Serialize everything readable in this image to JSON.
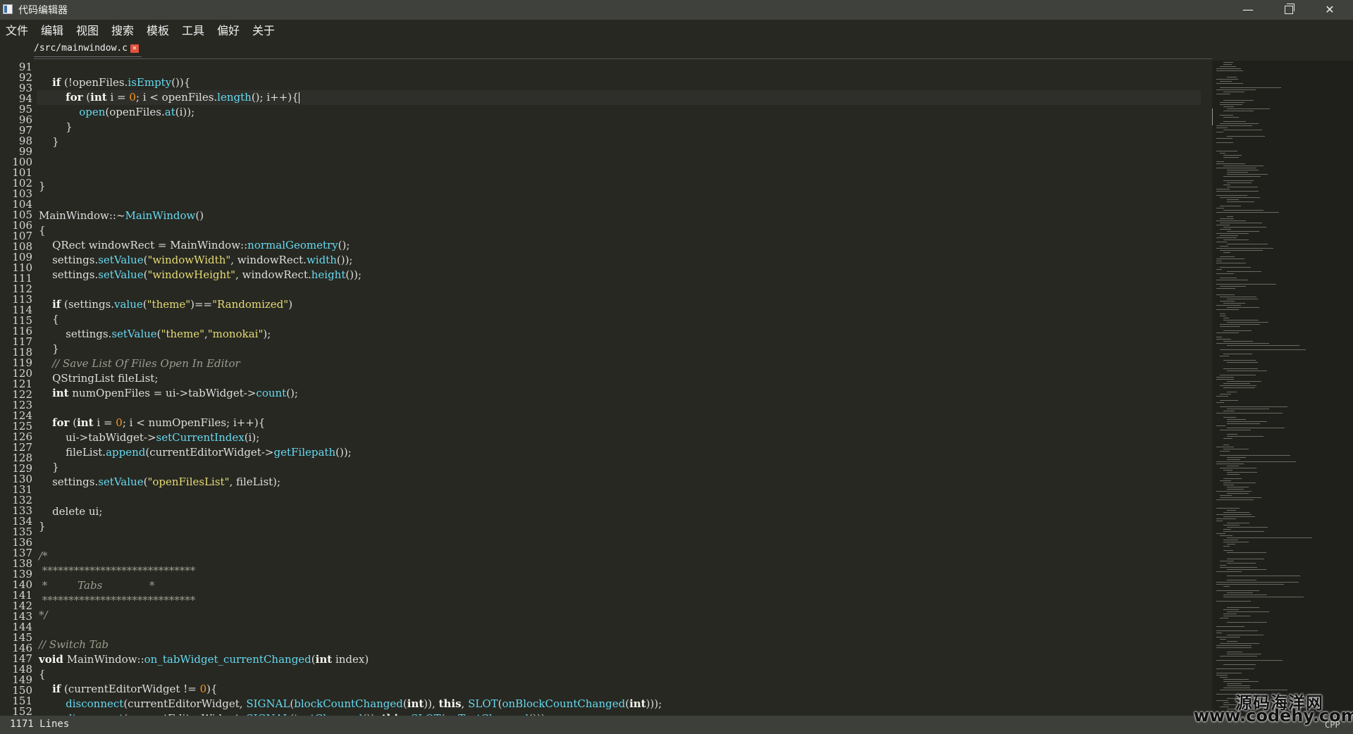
{
  "window": {
    "title": "代码编辑器",
    "minimize_glyph": "—",
    "close_glyph": "✕"
  },
  "menu": [
    "文件",
    "编辑",
    "视图",
    "搜索",
    "模板",
    "工具",
    "偏好",
    "关于"
  ],
  "tabs": [
    {
      "label": "/src/mainwindow.c",
      "close_glyph": "✕"
    }
  ],
  "editor": {
    "line_numbers": [
      "91",
      "92",
      "93",
      "94",
      "95",
      "96",
      "97",
      "98",
      "99",
      "100",
      "101",
      "102",
      "103",
      "104",
      "105",
      "106",
      "107",
      "108",
      "109",
      "110",
      "111",
      "112",
      "113",
      "114",
      "115",
      "116",
      "117",
      "118",
      "119",
      "120",
      "121",
      "122",
      "123",
      "124",
      "125",
      "126",
      "127",
      "128",
      "129",
      "130",
      "131",
      "132",
      "133",
      "134",
      "135",
      "136",
      "137",
      "138",
      "139",
      "140",
      "141",
      "142",
      "143",
      "144",
      "145",
      "146",
      "147",
      "148",
      "149",
      "150",
      "151",
      "152"
    ],
    "current_line": 94,
    "code_lines": [
      [],
      [
        {
          "t": "    "
        },
        {
          "c": "kw",
          "t": "if"
        },
        {
          "t": " (!openFiles."
        },
        {
          "c": "fn",
          "t": "isEmpty"
        },
        {
          "t": "()){"
        }
      ],
      [
        {
          "t": "        "
        },
        {
          "c": "kw",
          "t": "for"
        },
        {
          "t": " ("
        },
        {
          "c": "kw",
          "t": "int"
        },
        {
          "t": " i = "
        },
        {
          "c": "num",
          "t": "0"
        },
        {
          "t": "; i < openFiles."
        },
        {
          "c": "fn",
          "t": "length"
        },
        {
          "t": "(); i++){"
        }
      ],
      [
        {
          "t": "            "
        },
        {
          "c": "fn",
          "t": "open"
        },
        {
          "t": "(openFiles."
        },
        {
          "c": "fn",
          "t": "at"
        },
        {
          "t": "(i));"
        }
      ],
      [
        {
          "t": "        }"
        }
      ],
      [
        {
          "t": "    }"
        }
      ],
      [],
      [],
      [
        {
          "t": "}"
        }
      ],
      [],
      [
        {
          "t": "MainWindow::~"
        },
        {
          "c": "fn",
          "t": "MainWindow"
        },
        {
          "t": "()"
        }
      ],
      [
        {
          "t": "{"
        }
      ],
      [
        {
          "t": "    QRect windowRect = MainWindow::"
        },
        {
          "c": "fn",
          "t": "normalGeometry"
        },
        {
          "t": "();"
        }
      ],
      [
        {
          "t": "    settings."
        },
        {
          "c": "fn",
          "t": "setValue"
        },
        {
          "t": "("
        },
        {
          "c": "str",
          "t": "\"windowWidth\""
        },
        {
          "t": ", windowRect."
        },
        {
          "c": "fn",
          "t": "width"
        },
        {
          "t": "());"
        }
      ],
      [
        {
          "t": "    settings."
        },
        {
          "c": "fn",
          "t": "setValue"
        },
        {
          "t": "("
        },
        {
          "c": "str",
          "t": "\"windowHeight\""
        },
        {
          "t": ", windowRect."
        },
        {
          "c": "fn",
          "t": "height"
        },
        {
          "t": "());"
        }
      ],
      [],
      [
        {
          "t": "    "
        },
        {
          "c": "kw",
          "t": "if"
        },
        {
          "t": " (settings."
        },
        {
          "c": "fn",
          "t": "value"
        },
        {
          "t": "("
        },
        {
          "c": "str",
          "t": "\"theme\""
        },
        {
          "t": ")=="
        },
        {
          "c": "str",
          "t": "\"Randomized\""
        },
        {
          "t": ")"
        }
      ],
      [
        {
          "t": "    {"
        }
      ],
      [
        {
          "t": "        settings."
        },
        {
          "c": "fn",
          "t": "setValue"
        },
        {
          "t": "("
        },
        {
          "c": "str",
          "t": "\"theme\""
        },
        {
          "t": ","
        },
        {
          "c": "str",
          "t": "\"monokai\""
        },
        {
          "t": ");"
        }
      ],
      [
        {
          "t": "    }"
        }
      ],
      [
        {
          "t": "    "
        },
        {
          "c": "cm",
          "t": "// Save List Of Files Open In Editor"
        }
      ],
      [
        {
          "t": "    QStringList fileList;"
        }
      ],
      [
        {
          "t": "    "
        },
        {
          "c": "kw",
          "t": "int"
        },
        {
          "t": " numOpenFiles = ui->tabWidget->"
        },
        {
          "c": "fn",
          "t": "count"
        },
        {
          "t": "();"
        }
      ],
      [],
      [
        {
          "t": "    "
        },
        {
          "c": "kw",
          "t": "for"
        },
        {
          "t": " ("
        },
        {
          "c": "kw",
          "t": "int"
        },
        {
          "t": " i = "
        },
        {
          "c": "num",
          "t": "0"
        },
        {
          "t": "; i < numOpenFiles; i++){"
        }
      ],
      [
        {
          "t": "        ui->tabWidget->"
        },
        {
          "c": "fn",
          "t": "setCurrentIndex"
        },
        {
          "t": "(i);"
        }
      ],
      [
        {
          "t": "        fileList."
        },
        {
          "c": "fn",
          "t": "append"
        },
        {
          "t": "(currentEditorWidget->"
        },
        {
          "c": "fn",
          "t": "getFilepath"
        },
        {
          "t": "());"
        }
      ],
      [
        {
          "t": "    }"
        }
      ],
      [
        {
          "t": "    settings."
        },
        {
          "c": "fn",
          "t": "setValue"
        },
        {
          "t": "("
        },
        {
          "c": "str",
          "t": "\"openFilesList\""
        },
        {
          "t": ", fileList);"
        }
      ],
      [],
      [
        {
          "t": "    delete ui;"
        }
      ],
      [
        {
          "t": "}"
        }
      ],
      [],
      [
        {
          "c": "cm",
          "t": "/*"
        }
      ],
      [
        {
          "c": "cm",
          "t": " *****************************"
        }
      ],
      [
        {
          "c": "cm",
          "t": " *         Tabs              *"
        }
      ],
      [
        {
          "c": "cm",
          "t": " *****************************"
        }
      ],
      [
        {
          "c": "cm",
          "t": "*/"
        }
      ],
      [],
      [
        {
          "c": "cm",
          "t": "// Switch Tab"
        }
      ],
      [
        {
          "c": "kw",
          "t": "void"
        },
        {
          "t": " MainWindow::"
        },
        {
          "c": "fn",
          "t": "on_tabWidget_currentChanged"
        },
        {
          "t": "("
        },
        {
          "c": "kw",
          "t": "int"
        },
        {
          "t": " index)"
        }
      ],
      [
        {
          "t": "{"
        }
      ],
      [
        {
          "t": "    "
        },
        {
          "c": "kw",
          "t": "if"
        },
        {
          "t": " (currentEditorWidget != "
        },
        {
          "c": "num",
          "t": "0"
        },
        {
          "t": "){"
        }
      ],
      [
        {
          "t": "        "
        },
        {
          "c": "fn",
          "t": "disconnect"
        },
        {
          "t": "(currentEditorWidget, "
        },
        {
          "c": "fn",
          "t": "SIGNAL"
        },
        {
          "t": "("
        },
        {
          "c": "fn",
          "t": "blockCountChanged"
        },
        {
          "t": "("
        },
        {
          "c": "kw",
          "t": "int"
        },
        {
          "t": ")), "
        },
        {
          "c": "kw",
          "t": "this"
        },
        {
          "t": ", "
        },
        {
          "c": "fn",
          "t": "SLOT"
        },
        {
          "t": "("
        },
        {
          "c": "fn",
          "t": "onBlockCountChanged"
        },
        {
          "t": "("
        },
        {
          "c": "kw",
          "t": "int"
        },
        {
          "t": ")));"
        }
      ],
      [
        {
          "t": "        "
        },
        {
          "c": "fn",
          "t": "disconnect"
        },
        {
          "t": "(currentEditorWidget, "
        },
        {
          "c": "fn",
          "t": "SIGNAL"
        },
        {
          "t": "("
        },
        {
          "c": "fn",
          "t": "textChanged"
        },
        {
          "t": "()), "
        },
        {
          "c": "kw",
          "t": "this"
        },
        {
          "t": ", "
        },
        {
          "c": "fn",
          "t": "SLOT"
        },
        {
          "t": "("
        },
        {
          "c": "fn",
          "t": "onTextChanged"
        },
        {
          "t": "()));"
        }
      ],
      [
        {
          "t": "    }"
        }
      ]
    ]
  },
  "status": {
    "line_count": "1171 Lines",
    "language": "CPP"
  },
  "watermark": {
    "cn": "源码海洋网",
    "url": "www.codehy.com"
  },
  "theme": {
    "background": "#272822",
    "keyword": "#f8f8f2",
    "function": "#66d9ef",
    "string": "#e6db74",
    "number": "#fd971f",
    "comment": "#9d9d8e",
    "tab_close": "#e2523c"
  }
}
